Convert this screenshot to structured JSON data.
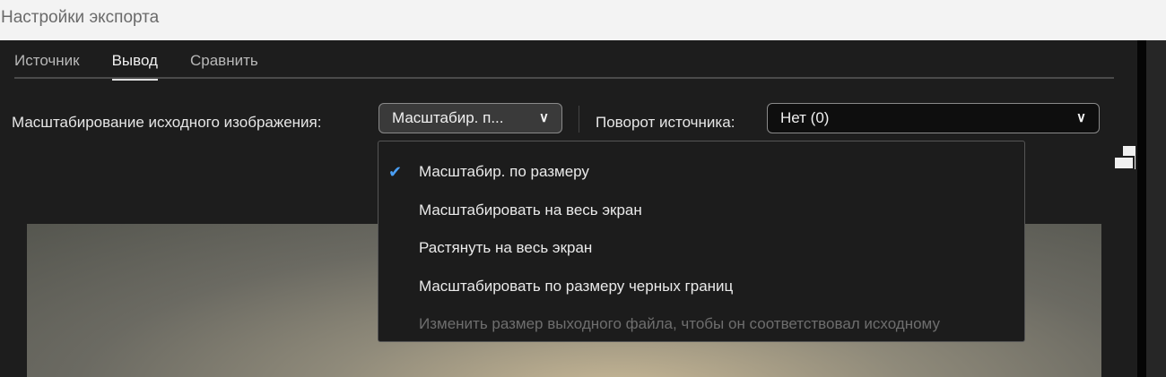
{
  "window": {
    "title": "Настройки экспорта"
  },
  "tabs": [
    {
      "label": "Источник"
    },
    {
      "label": "Вывод"
    },
    {
      "label": "Сравнить"
    }
  ],
  "scaling": {
    "label": "Масштабирование исходного изображения:",
    "value": "Масштабир. п..."
  },
  "rotation": {
    "label": "Поворот источника:",
    "value": "Нет (0)"
  },
  "menu": {
    "items": [
      {
        "label": "Масштабир. по размеру",
        "checked": true
      },
      {
        "label": "Масштабировать на весь экран"
      },
      {
        "label": "Растянуть на весь экран"
      },
      {
        "label": "Масштабировать по размеру черных границ"
      },
      {
        "label": "Изменить размер выходного файла, чтобы он соответствовал исходному",
        "disabled": true
      }
    ]
  }
}
